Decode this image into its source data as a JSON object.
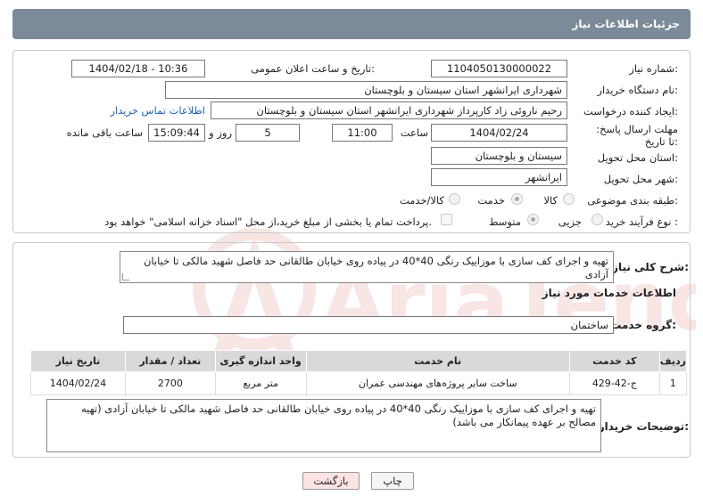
{
  "header": {
    "title": "جزئیات اطلاعات نیاز"
  },
  "form": {
    "need_number_label": "شماره نیاز:",
    "need_number": "1104050130000022",
    "announce_label": "تاریخ و ساعت اعلان عمومی:",
    "announce_value": "1404/02/18 - 10:36",
    "buyer_org_label": "نام دستگاه خریدار:",
    "buyer_org": "شهرداری ایرانشهر استان سیستان و بلوچستان",
    "creator_label": "ایجاد کننده درخواست:",
    "creator": "رحیم ناروئی زاد کارپرداز شهرداری ایرانشهر استان سیستان و بلوچستان",
    "contact_link": "اطلاعات تماس خریدار",
    "deadline_label": "مهلت ارسال پاسخ: تا تاریخ:",
    "deadline_date": "1404/02/24",
    "time_label": "ساعت",
    "deadline_time": "11:00",
    "days_value": "5",
    "days_label": "روز و",
    "remaining_time": "15:09:44",
    "remaining_label": "ساعت باقی مانده",
    "province_label": "استان محل تحویل:",
    "province": "سیستان و بلوچستان",
    "city_label": "شهر محل تحویل:",
    "city": "ایرانشهر",
    "category_label": "طبقه بندی موضوعی:",
    "category_options": [
      "کالا",
      "خدمت",
      "کالا/خدمت"
    ],
    "purchase_type_label": "نوع فرآیند خرید :",
    "purchase_options": [
      "جزیی",
      "متوسط"
    ],
    "payment_note": "پرداخت تمام یا بخشی از مبلغ خرید،از محل \"اسناد خزانه اسلامی\" خواهد بود."
  },
  "description": {
    "label": "شرح کلی نیاز:",
    "text": "تهیه و اجرای کف سازی با موزاییک رنگی 40*40 در پیاده روی خیابان طالقانی حد فاصل شهید مالکی تا خیابان آزادی"
  },
  "services": {
    "section_title": "اطلاعات خدمات مورد نیاز",
    "group_label": "گروه خدمت:",
    "group_value": "ساختمان",
    "columns": [
      "ردیف",
      "کد خدمت",
      "نام خدمت",
      "واحد اندازه گیری",
      "تعداد / مقدار",
      "تاریخ نیاز"
    ],
    "rows": [
      [
        "1",
        "ج-42-429",
        "ساخت سایر پروژه‌های مهندسی عمران",
        "متر مربع",
        "2700",
        "1404/02/24"
      ]
    ]
  },
  "buyer_notes": {
    "label": "توضیحات خریدار:",
    "text": "تهیه و اجرای کف سازی با موزاییک رنگی 40*40 در پیاده روی خیابان طالقانی حد فاصل شهید مالکی تا خیابان آزادی (تهیه مصالح بر عهده پیمانکار می باشد)"
  },
  "buttons": {
    "print": "چاپ",
    "back": "بازگشت"
  },
  "watermark": {
    "text": "AriaTender.neT"
  },
  "colors": {
    "header_bg": "#7c8a9a",
    "link": "#1f5fb8",
    "back_button_bg": "#fde3e3",
    "table_header_bg": "#d9d9d9"
  }
}
